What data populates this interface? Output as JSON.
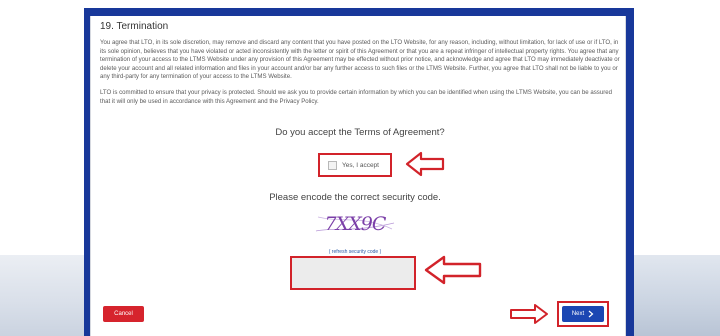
{
  "terms": {
    "section_title": "19. Termination",
    "paragraph_1": "You agree that LTO, in its sole discretion, may remove and discard any content that you have posted on the LTO Website, for any reason, including, without limitation, for lack of use or if LTO, in its sole opinion, believes that you have violated or acted inconsistently with the letter or spirit of this Agreement or that you are a repeat infringer of intellectual property rights. You agree that any termination of your access to the LTMS Website under any provision of this Agreement may be effected without prior notice, and acknowledge and agree that LTO may immediately deactivate or delete your account and all related information and files in your account and/or bar any further access to such files or the LTMS Website. Further, you agree that LTO shall not be liable to you or any third-party for any termination of your access to the LTMS Website.",
    "paragraph_2": "LTO is committed to ensure that your privacy is protected. Should we ask you to provide certain information by which you can be identified when using the LTMS Website, you can be assured that it will only be used in accordance with this Agreement and the Privacy Policy."
  },
  "agreement": {
    "question": "Do you accept the Terms of Agreement?",
    "accept_label": "Yes, I accept",
    "accepted": false
  },
  "security": {
    "label": "Please encode the correct security code.",
    "captcha_text": "7XX9C",
    "refresh_label": "( refresh security code )",
    "input_value": "",
    "input_placeholder": ""
  },
  "buttons": {
    "cancel_label": "Cancel",
    "next_label": "Next"
  },
  "colors": {
    "frame_blue": "#18389a",
    "annotation_red": "#d2232a",
    "cancel_red": "#d6242d",
    "next_blue": "#1b46b3",
    "captcha_purple": "#7b3fa8"
  },
  "icons": {
    "next_icon": "chevron-right-icon",
    "annotation_icon": "arrow-left-icon"
  }
}
